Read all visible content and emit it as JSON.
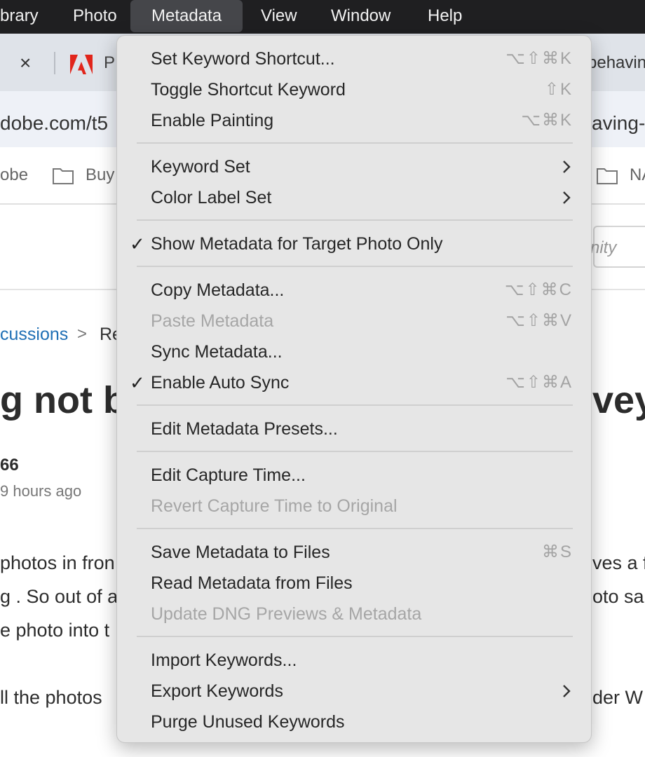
{
  "menubar": {
    "items": [
      "brary",
      "Photo",
      "Metadata",
      "View",
      "Window",
      "Help"
    ]
  },
  "browser": {
    "tab_close_symbol": "×",
    "tab_left_text": "P",
    "tab_right_text": "behavin",
    "address_left": "dobe.com/t5",
    "address_right": "aving-",
    "bookmarks": [
      "obe",
      "Buy",
      "NA"
    ]
  },
  "page": {
    "community_text": "nity",
    "breadcrumb_link": "cussions",
    "breadcrumb_sep": ">",
    "breadcrumb_next": "Re",
    "title_left": "g not b",
    "title_right": "vey",
    "author": "66",
    "time": "9 hours ago",
    "body_lines": [
      {
        "left": "photos in fron",
        "right": "ves a f"
      },
      {
        "left": "g .  So out of a",
        "right": "oto sa"
      },
      {
        "left": "e photo into t",
        "right": ""
      },
      {
        "left": "ll the photos",
        "right": "der  W"
      }
    ]
  },
  "menu": {
    "items": [
      {
        "label": "Set Keyword Shortcut...",
        "shortcut": "⌥⇧⌘K",
        "disabled": false,
        "checked": false,
        "submenu": false
      },
      {
        "label": "Toggle Shortcut Keyword",
        "shortcut": "⇧K",
        "disabled": false,
        "checked": false,
        "submenu": false
      },
      {
        "label": "Enable Painting",
        "shortcut": "⌥⌘K",
        "disabled": false,
        "checked": false,
        "submenu": false
      },
      {
        "label": "Keyword Set",
        "shortcut": "",
        "disabled": false,
        "checked": false,
        "submenu": true
      },
      {
        "label": "Color Label Set",
        "shortcut": "",
        "disabled": false,
        "checked": false,
        "submenu": true
      },
      {
        "label": "Show Metadata for Target Photo Only",
        "shortcut": "",
        "disabled": false,
        "checked": true,
        "submenu": false
      },
      {
        "label": "Copy Metadata...",
        "shortcut": "⌥⇧⌘C",
        "disabled": false,
        "checked": false,
        "submenu": false
      },
      {
        "label": "Paste Metadata",
        "shortcut": "⌥⇧⌘V",
        "disabled": true,
        "checked": false,
        "submenu": false
      },
      {
        "label": "Sync Metadata...",
        "shortcut": "",
        "disabled": false,
        "checked": false,
        "submenu": false
      },
      {
        "label": "Enable Auto Sync",
        "shortcut": "⌥⇧⌘A",
        "disabled": false,
        "checked": true,
        "submenu": false
      },
      {
        "label": "Edit Metadata Presets...",
        "shortcut": "",
        "disabled": false,
        "checked": false,
        "submenu": false
      },
      {
        "label": "Edit Capture Time...",
        "shortcut": "",
        "disabled": false,
        "checked": false,
        "submenu": false
      },
      {
        "label": "Revert Capture Time to Original",
        "shortcut": "",
        "disabled": true,
        "checked": false,
        "submenu": false
      },
      {
        "label": "Save Metadata to Files",
        "shortcut": "⌘S",
        "disabled": false,
        "checked": false,
        "submenu": false
      },
      {
        "label": "Read Metadata from Files",
        "shortcut": "",
        "disabled": false,
        "checked": false,
        "submenu": false
      },
      {
        "label": "Update DNG Previews & Metadata",
        "shortcut": "",
        "disabled": true,
        "checked": false,
        "submenu": false
      },
      {
        "label": "Import Keywords...",
        "shortcut": "",
        "disabled": false,
        "checked": false,
        "submenu": false
      },
      {
        "label": "Export Keywords",
        "shortcut": "",
        "disabled": false,
        "checked": false,
        "submenu": true
      },
      {
        "label": "Purge Unused Keywords",
        "shortcut": "",
        "disabled": false,
        "checked": false,
        "submenu": false
      }
    ],
    "check_symbol": "✓"
  },
  "colors": {
    "menubar_bg": "#1f1f21",
    "menu_bg": "#e6e6e6",
    "link_blue": "#1f6fb5",
    "adobe_red": "#e1251b"
  }
}
